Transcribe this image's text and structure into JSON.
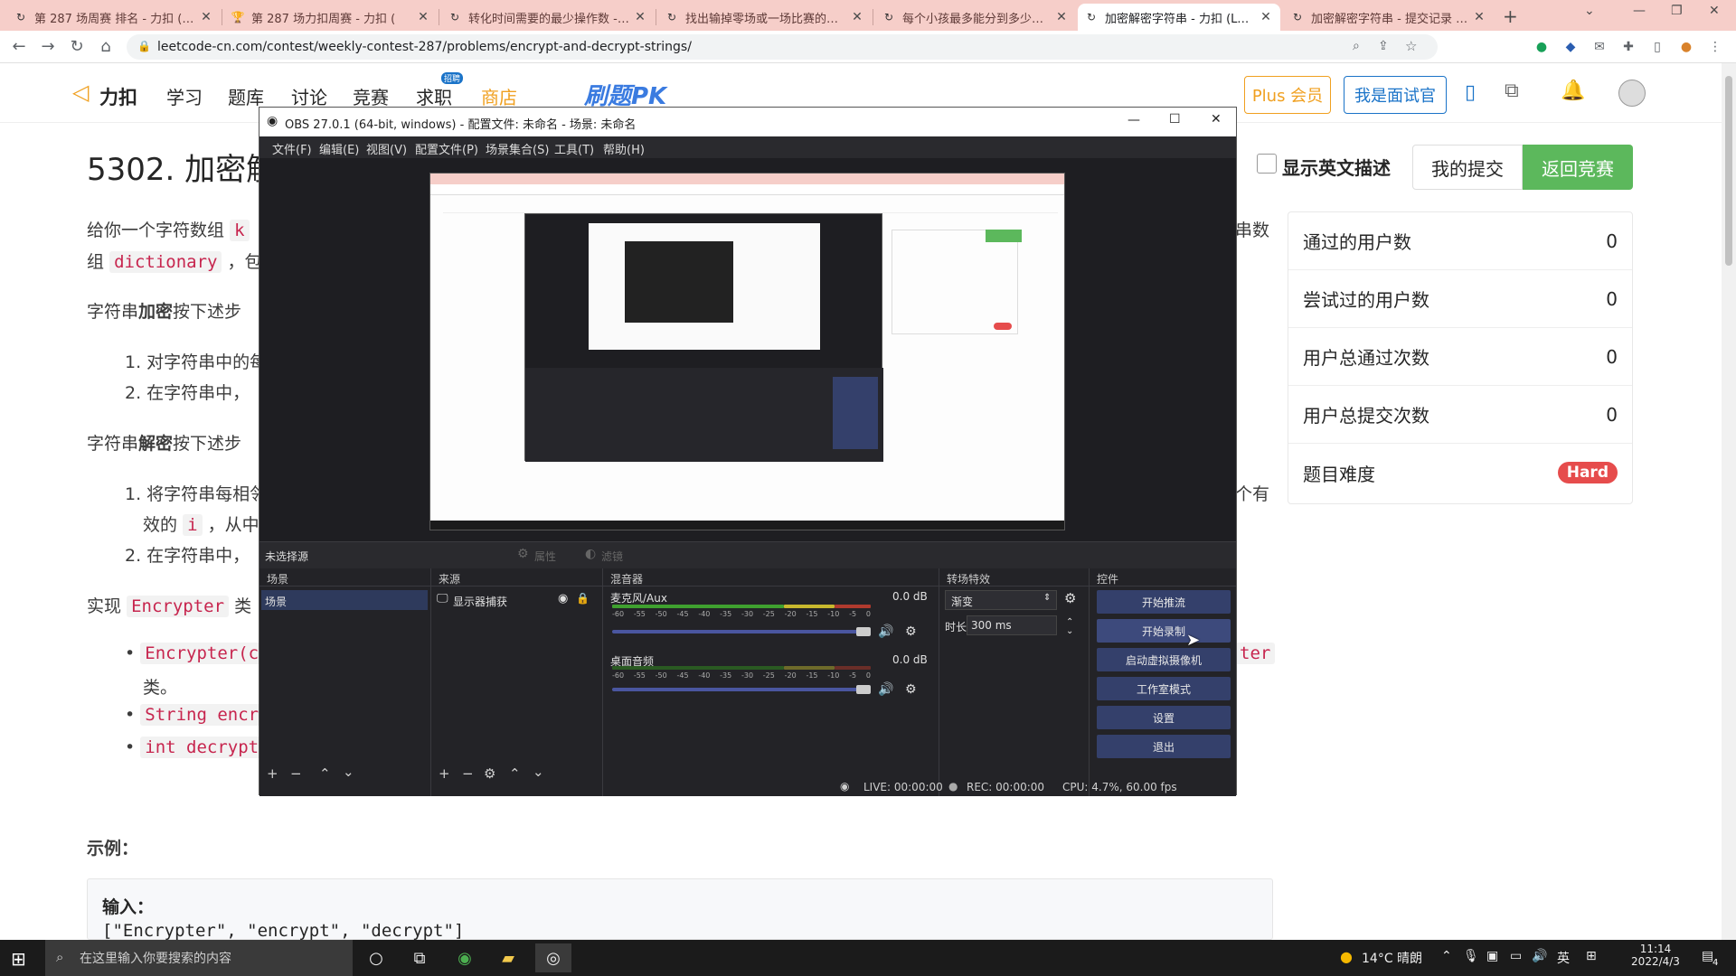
{
  "browser": {
    "tabs": [
      {
        "label": "第 287 场周赛 排名 - 力扣 (Le",
        "icon": "leetcode-icon"
      },
      {
        "label": "第 287 场力扣周赛 - 力扣 (",
        "icon": "trophy-icon"
      },
      {
        "label": "转化时间需要的最少操作数 - 力",
        "icon": "leetcode-icon"
      },
      {
        "label": "找出输掉零场或一场比赛的玩家",
        "icon": "leetcode-icon"
      },
      {
        "label": "每个小孩最多能分到多少糖果 -",
        "icon": "leetcode-icon"
      },
      {
        "label": "加密解密字符串 - 力扣 (LeetCo",
        "icon": "leetcode-icon"
      },
      {
        "label": "加密解密字符串 - 提交记录 - 力",
        "icon": "leetcode-icon"
      }
    ],
    "active_tab": 5,
    "url": "leetcode-cn.com/contest/weekly-contest-287/problems/encrypt-and-decrypt-strings/",
    "tab_close": "✕",
    "new_tab": "+"
  },
  "lc_header": {
    "logo": "力扣",
    "nav": [
      "学习",
      "题库",
      "讨论",
      "竞赛",
      "求职",
      "商店"
    ],
    "job_badge": "招聘",
    "pk_label": "刷题PK",
    "plus_button": "Plus 会员",
    "interviewer_button": "我是面试官"
  },
  "problem": {
    "title": "5302. 加密解",
    "intro_1": "给你一个字符数组",
    "intro_1_code": "k",
    "intro_right": "串数",
    "intro_2_pre": "组",
    "intro_2_code": "dictionary",
    "intro_2_post": "，包",
    "encrypt_pre": "字符串",
    "encrypt_bold": "加密",
    "encrypt_post": "按下述步",
    "enc_step_1": "1. 对字符串中的每",
    "enc_step_2": "2. 在字符串中，",
    "decrypt_pre": "字符串",
    "decrypt_bold": "解密",
    "decrypt_post": "按下述步",
    "dec_step_1": "1. 将字符串每相邻",
    "dec_step_1_right": "个有",
    "dec_step_1b_pre": "效的",
    "dec_step_1b_code": "i",
    "dec_step_1b_post": "，从中",
    "dec_step_2": "2. 在字符串中，",
    "impl_pre": "实现",
    "impl_code": "Encrypter",
    "impl_post": "类",
    "bullet_1": "Encrypter(c",
    "bullet_1_right": "ter",
    "bullet_1_cont": "类。",
    "bullet_2": "String encr",
    "bullet_3": "int decrypt",
    "example_title": "示例：",
    "input_label": "输入：",
    "input_value": "[\"Encrypter\", \"encrypt\", \"decrypt\"]",
    "show_english": "显示英文描述",
    "my_submissions": "我的提交",
    "back_to_contest": "返回竞赛"
  },
  "stats": [
    {
      "label": "通过的用户数",
      "value": "0"
    },
    {
      "label": "尝试过的用户数",
      "value": "0"
    },
    {
      "label": "用户总通过次数",
      "value": "0"
    },
    {
      "label": "用户总提交次数",
      "value": "0"
    }
  ],
  "difficulty": {
    "label": "题目难度",
    "value": "Hard",
    "color": "#e64c4c"
  },
  "obs": {
    "title": "OBS 27.0.1 (64-bit, windows) - 配置文件: 未命名 - 场景: 未命名",
    "menu": [
      "文件(F)",
      "编辑(E)",
      "视图(V)",
      "配置文件(P)",
      "场景集合(S)",
      "工具(T)",
      "帮助(H)"
    ],
    "no_source": "未选择源",
    "properties": "属性",
    "filters": "滤镜",
    "docks": {
      "scenes": "场景",
      "sources": "来源",
      "mixer": "混音器",
      "transitions": "转场特效",
      "controls": "控件"
    },
    "scene_item": "场景",
    "source_item": "显示器捕获",
    "mixer_tracks": [
      {
        "name": "麦克风/Aux",
        "db": "0.0 dB"
      },
      {
        "name": "桌面音频",
        "db": "0.0 dB"
      }
    ],
    "meter_ticks": [
      "-60",
      "-55",
      "-50",
      "-45",
      "-40",
      "-35",
      "-30",
      "-25",
      "-20",
      "-15",
      "-10",
      "-5",
      "0"
    ],
    "transition": "渐变",
    "duration_label": "时长",
    "duration_value": "300 ms",
    "controls": [
      "开始推流",
      "开始录制",
      "启动虚拟摄像机",
      "工作室模式",
      "设置",
      "退出"
    ],
    "status_live": "LIVE: 00:00:00",
    "status_rec": "REC: 00:00:00",
    "status_cpu": "CPU: 4.7%, 60.00 fps",
    "accent": "#34406b"
  },
  "taskbar": {
    "search_placeholder": "在这里输入你要搜索的内容",
    "weather": "14°C 晴朗",
    "ime": "英",
    "time": "11:14",
    "date": "2022/4/3",
    "notifications": "4"
  }
}
